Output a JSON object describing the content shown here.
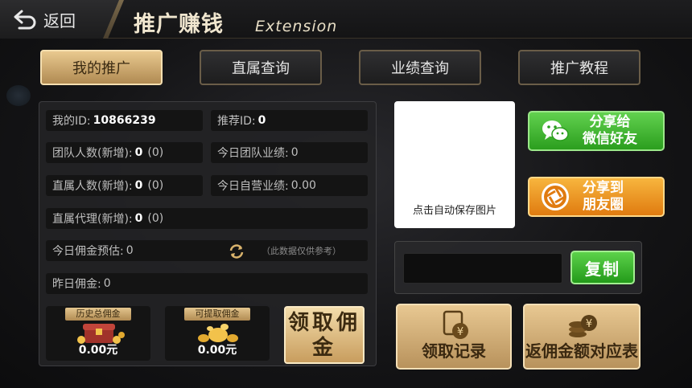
{
  "header": {
    "back_label": "返回",
    "title": "推广赚钱",
    "title_en": "Extension"
  },
  "tabs": [
    {
      "label": "我的推广",
      "active": true
    },
    {
      "label": "直属查询",
      "active": false
    },
    {
      "label": "业绩查询",
      "active": false
    },
    {
      "label": "推广教程",
      "active": false
    }
  ],
  "stats": {
    "my_id_label": "我的ID:",
    "my_id": "10866239",
    "referrer_label": "推荐ID:",
    "referrer": "0",
    "team_label": "团队人数(新增):",
    "team_count": "0",
    "team_new": "(0)",
    "team_perf_label": "今日团队业绩:",
    "team_perf": "0",
    "direct_label": "直属人数(新增):",
    "direct_count": "0",
    "direct_new": "(0)",
    "self_perf_label": "今日自营业绩:",
    "self_perf": "0.00",
    "agent_label": "直属代理(新增):",
    "agent_count": "0",
    "agent_new": "(0)",
    "est_label": "今日佣金预估:",
    "est_value": "0",
    "est_note": "（此数据仅供参考）",
    "yesterday_label": "昨日佣金:",
    "yesterday_value": "0"
  },
  "commission": {
    "history_label": "历史总佣金",
    "history_value": "0.00元",
    "withdrawable_label": "可提取佣金",
    "withdrawable_value": "0.00元",
    "claim_label": "领取佣金"
  },
  "qr": {
    "caption": "点击自动保存图片"
  },
  "share": {
    "wechat": "分享给\n微信好友",
    "moments": "分享到\n朋友圈"
  },
  "link": {
    "value": "",
    "copy_label": "复制"
  },
  "actions": {
    "records_label": "领取记录",
    "rebate_table_label": "返佣金额对应表"
  },
  "colors": {
    "gold": "#e8c892",
    "wechat_green": "#2b9e1e",
    "moments_orange": "#e07b10"
  }
}
